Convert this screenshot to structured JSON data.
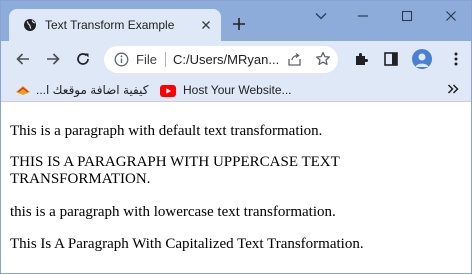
{
  "tab": {
    "title": "Text Transform Example",
    "favicon": "globe-icon",
    "close_icon": "close-icon"
  },
  "window_controls": [
    "chevron-down-icon",
    "minimize-icon",
    "maximize-icon",
    "close-icon"
  ],
  "toolbar": {
    "back_icon": "back-arrow-icon",
    "forward_icon": "forward-arrow-icon",
    "reload_icon": "reload-icon",
    "omnibox": {
      "scheme_label": "File",
      "url": "C:/Users/MRyan...",
      "info_icon": "info-icon",
      "share_icon": "share-icon",
      "star_icon": "star-icon"
    },
    "extensions_icon": "puzzle-icon",
    "sidepanel_icon": "side-panel-icon",
    "profile_icon": "avatar",
    "menu_icon": "more-vertical-icon"
  },
  "bookmarks": {
    "items": [
      {
        "label": "كيفية اضافة موقعك ا...",
        "icon": "bookmark-favicon-icon"
      },
      {
        "label": "Host Your Website...",
        "icon": "youtube-icon"
      }
    ],
    "overflow_icon": "double-chevron-icon"
  },
  "page": {
    "paragraphs": [
      "This is a paragraph with default text transformation.",
      "This is a paragraph with uppercase text transformation.",
      "This is a paragraph with lowercase text transformation.",
      "This is a paragraph with capitalized text transformation."
    ]
  },
  "colors": {
    "tabstrip": "#8eacd9",
    "toolbar": "#dfe8f7",
    "avatar": "#4a7fd6",
    "youtube_red": "#ff0000"
  }
}
